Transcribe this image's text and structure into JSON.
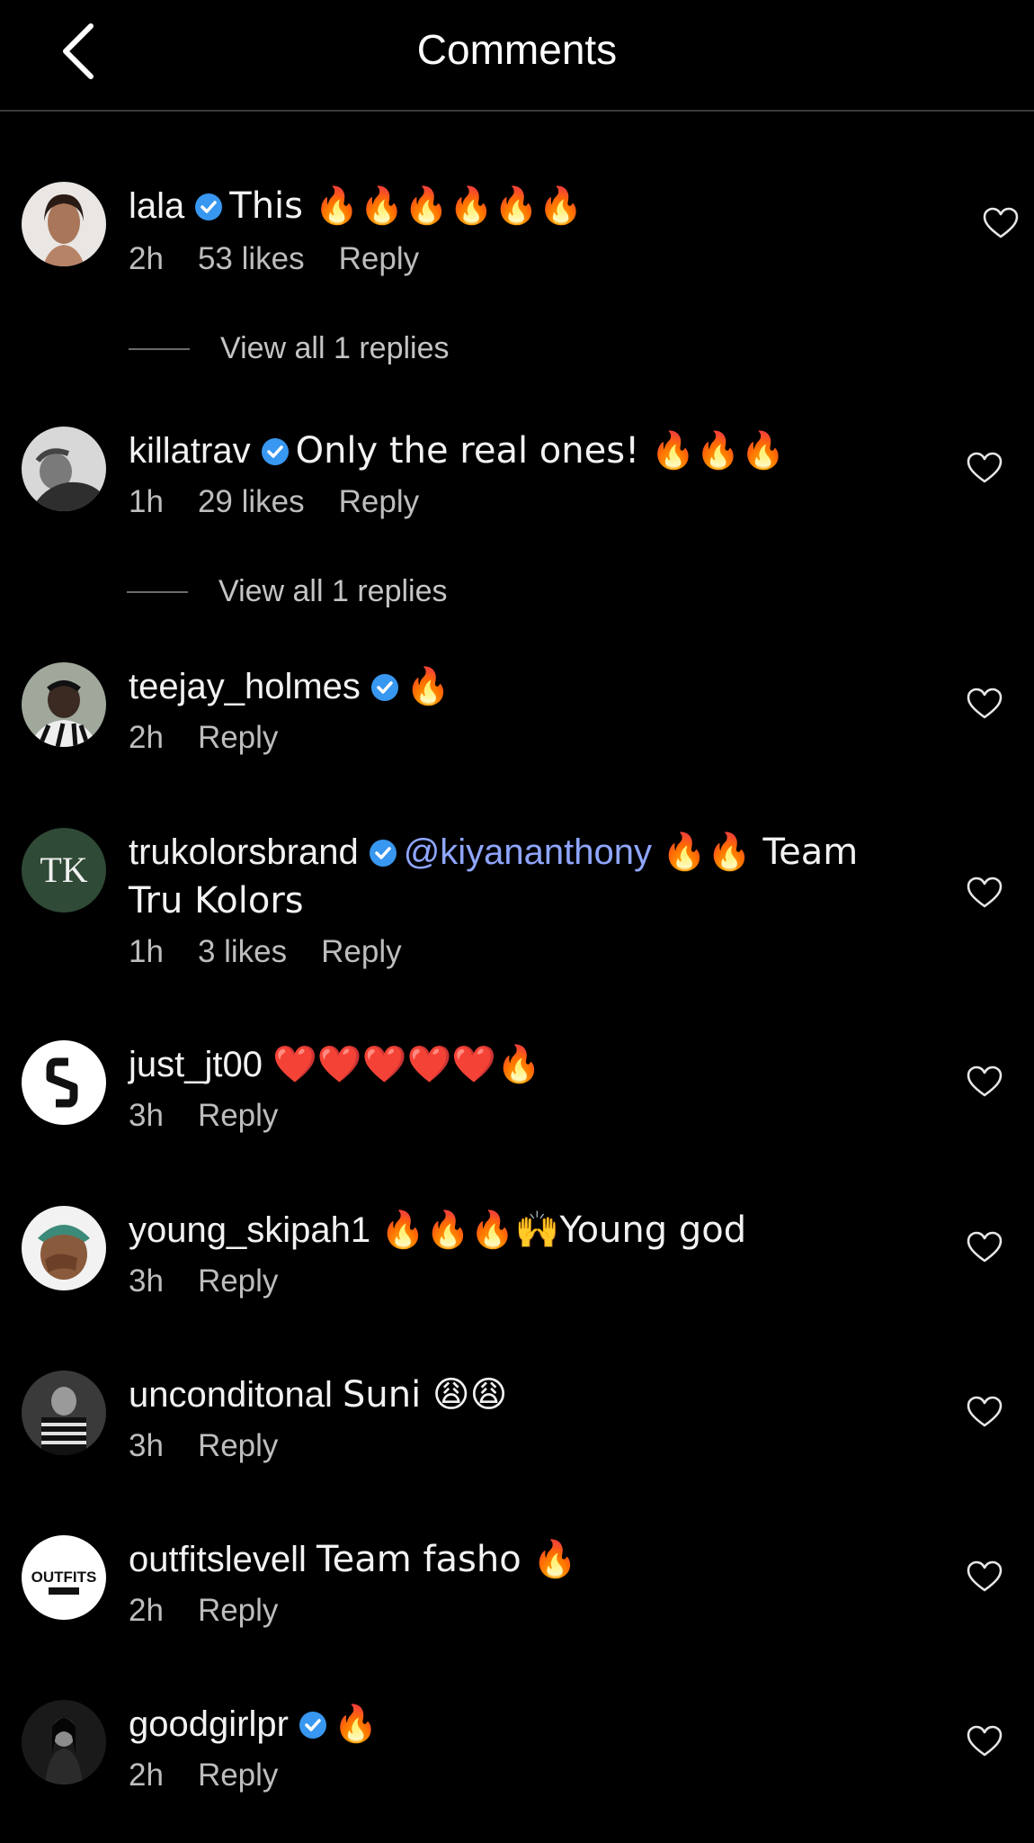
{
  "header": {
    "title": "Comments"
  },
  "colors": {
    "background": "#000000",
    "verified_badge": "#3897f0",
    "mention": "#8fa6ff",
    "secondary_text": "#bdbdbd"
  },
  "icons": {
    "back": "chevron-left-icon",
    "verified": "verified-badge-icon",
    "like": "heart-outline-icon"
  },
  "comments": [
    {
      "username": "lala",
      "verified": true,
      "text": "This 🔥🔥🔥🔥🔥🔥",
      "time": "2h",
      "likes": "53 likes",
      "reply": "Reply",
      "view_replies": "View all 1 replies"
    },
    {
      "username": "killatrav",
      "verified": true,
      "text": "Only the real ones! 🔥🔥🔥",
      "time": "1h",
      "likes": "29 likes",
      "reply": "Reply",
      "view_replies": "View all 1 replies"
    },
    {
      "username": "teejay_holmes",
      "verified": true,
      "text": "🔥",
      "time": "2h",
      "reply": "Reply"
    },
    {
      "username": "trukolorsbrand",
      "verified": true,
      "mention": "@kiyananthony",
      "text": "🔥🔥 Team Tru Kolors",
      "time": "1h",
      "likes": "3 likes",
      "reply": "Reply",
      "avatar_text": "TK"
    },
    {
      "username": "just_jt00",
      "verified": false,
      "text": "❤️❤️❤️❤️❤️🔥",
      "time": "3h",
      "reply": "Reply"
    },
    {
      "username": "young_skipah1",
      "verified": false,
      "text": "🔥🔥🔥🙌Young god",
      "time": "3h",
      "reply": "Reply"
    },
    {
      "username": "unconditonal",
      "verified": false,
      "text": "Suni 😩😩",
      "time": "3h",
      "reply": "Reply"
    },
    {
      "username": "outfitslevell",
      "verified": false,
      "text": "Team fasho 🔥",
      "time": "2h",
      "reply": "Reply",
      "avatar_text": "OUTFITS"
    },
    {
      "username": "goodgirlpr",
      "verified": true,
      "text": "🔥",
      "time": "2h",
      "reply": "Reply"
    }
  ]
}
